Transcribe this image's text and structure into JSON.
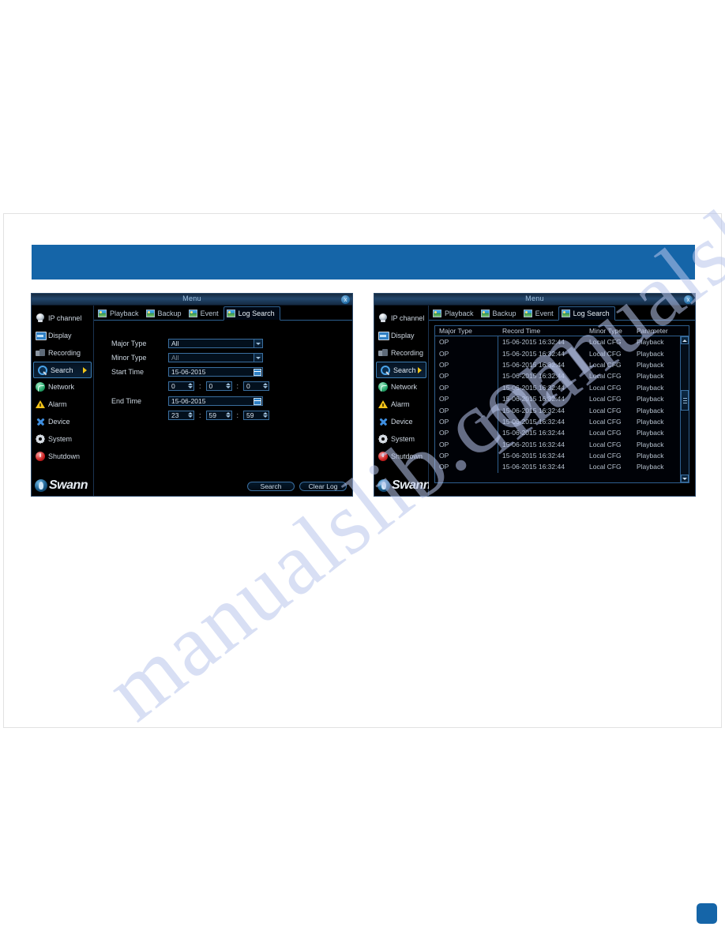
{
  "page": {
    "watermark_text": "manualslib.com",
    "banner_color": "#1565a8",
    "corner_chip_color": "#1565a8"
  },
  "windows": [
    {
      "id": "left",
      "title": "Menu",
      "close_label": "x",
      "sidebar": {
        "items": [
          {
            "label": "IP channel",
            "icon": "camera-icon",
            "active": false
          },
          {
            "label": "Display",
            "icon": "monitor-icon",
            "active": false
          },
          {
            "label": "Recording",
            "icon": "recorder-icon",
            "active": false
          },
          {
            "label": "Search",
            "icon": "magnifier-icon",
            "active": true
          },
          {
            "label": "Network",
            "icon": "globe-icon",
            "active": false
          },
          {
            "label": "Alarm",
            "icon": "warning-triangle-icon",
            "active": false
          },
          {
            "label": "Device",
            "icon": "wrench-cross-icon",
            "active": false
          },
          {
            "label": "System",
            "icon": "gear-icon",
            "active": false
          },
          {
            "label": "Shutdown",
            "icon": "power-icon",
            "active": false
          }
        ],
        "brand": "Swann"
      },
      "tabs": [
        {
          "label": "Playback",
          "icon": "image-icon",
          "active": false
        },
        {
          "label": "Backup",
          "icon": "image-icon",
          "active": false
        },
        {
          "label": "Event",
          "icon": "image-icon",
          "active": false
        },
        {
          "label": "Log Search",
          "icon": "image-icon",
          "active": true
        }
      ],
      "form": {
        "major_type": {
          "label": "Major Type",
          "value": "All",
          "dimmed": false
        },
        "minor_type": {
          "label": "Minor Type",
          "value": "All",
          "dimmed": true
        },
        "start_time": {
          "label": "Start Time",
          "date": "15-06-2015",
          "hour": "0",
          "minute": "0",
          "second": "0"
        },
        "end_time": {
          "label": "End Time",
          "date": "15-06-2015",
          "hour": "23",
          "minute": "59",
          "second": "59"
        },
        "separator": ":"
      },
      "buttons": [
        {
          "label": "Search"
        },
        {
          "label": "Clear Log"
        }
      ]
    },
    {
      "id": "right",
      "title": "Menu",
      "close_label": "x",
      "sidebar": {
        "items": [
          {
            "label": "IP channel",
            "icon": "camera-icon",
            "active": false
          },
          {
            "label": "Display",
            "icon": "monitor-icon",
            "active": false
          },
          {
            "label": "Recording",
            "icon": "recorder-icon",
            "active": false
          },
          {
            "label": "Search",
            "icon": "magnifier-icon",
            "active": true
          },
          {
            "label": "Network",
            "icon": "globe-icon",
            "active": false
          },
          {
            "label": "Alarm",
            "icon": "warning-triangle-icon",
            "active": false
          },
          {
            "label": "Device",
            "icon": "wrench-cross-icon",
            "active": false
          },
          {
            "label": "System",
            "icon": "gear-icon",
            "active": false
          },
          {
            "label": "Shutdown",
            "icon": "power-icon",
            "active": false
          }
        ],
        "brand": "Swann"
      },
      "tabs": [
        {
          "label": "Playback",
          "icon": "image-icon",
          "active": false
        },
        {
          "label": "Backup",
          "icon": "image-icon",
          "active": false
        },
        {
          "label": "Event",
          "icon": "image-icon",
          "active": false
        },
        {
          "label": "Log Search",
          "icon": "image-icon",
          "active": true
        }
      ],
      "log_table": {
        "columns": [
          "Major Type",
          "Record Time",
          "Minor Type",
          "Parameter"
        ],
        "rows": [
          [
            "OP",
            "15-06-2015 16:32:44",
            "Local CFG",
            "Playback"
          ],
          [
            "OP",
            "15-06-2015 16:32:44",
            "Local CFG",
            "Playback"
          ],
          [
            "OP",
            "15-06-2015 16:32:44",
            "Local CFG",
            "Playback"
          ],
          [
            "OP",
            "15-06-2015 16:32:44",
            "Local CFG",
            "Playback"
          ],
          [
            "OP",
            "15-06-2015 16:32:44",
            "Local CFG",
            "Playback"
          ],
          [
            "OP",
            "15-06-2015 16:32:44",
            "Local CFG",
            "Playback"
          ],
          [
            "OP",
            "15-06-2015 16:32:44",
            "Local CFG",
            "Playback"
          ],
          [
            "OP",
            "15-06-2015 16:32:44",
            "Local CFG",
            "Playback"
          ],
          [
            "OP",
            "15-06-2015 16:32:44",
            "Local CFG",
            "Playback"
          ],
          [
            "OP",
            "15-06-2015 16:32:44",
            "Local CFG",
            "Playback"
          ],
          [
            "OP",
            "15-06-2015 16:32:44",
            "Local CFG",
            "Playback"
          ],
          [
            "OP",
            "15-06-2015 16:32:44",
            "Local CFG",
            "Playback"
          ]
        ]
      }
    }
  ]
}
